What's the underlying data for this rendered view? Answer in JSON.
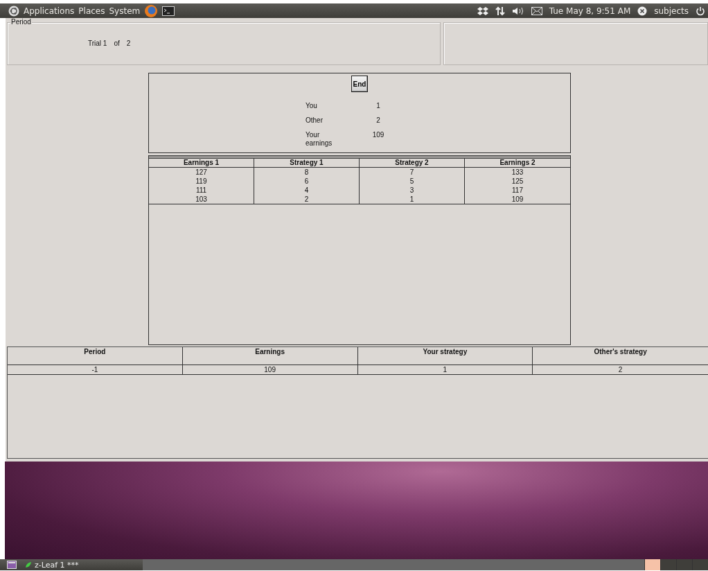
{
  "top_panel": {
    "menus": [
      "Applications",
      "Places",
      "System"
    ],
    "clock": "Tue May 8, 9:51 AM",
    "user": "subjects"
  },
  "period_box": {
    "title": "Period",
    "trial_label": "Trial 1",
    "of_label": "of",
    "total": "2"
  },
  "end_button": "End",
  "info": [
    {
      "label": "You",
      "value": "1"
    },
    {
      "label": "Other",
      "value": "2"
    },
    {
      "label": "Your earnings",
      "value": "109"
    }
  ],
  "strategy_table": {
    "columns": [
      "Earnings 1",
      "Strategy 1",
      "Strategy 2",
      "Earnings 2"
    ],
    "rows": [
      [
        "127",
        "8",
        "7",
        "133"
      ],
      [
        "119",
        "6",
        "5",
        "125"
      ],
      [
        "111",
        "4",
        "3",
        "117"
      ],
      [
        "103",
        "2",
        "1",
        "109"
      ]
    ]
  },
  "history_table": {
    "columns": [
      "Period",
      "Earnings",
      "Your strategy",
      "Other's strategy"
    ],
    "rows": [
      [
        "-1",
        "109",
        "1",
        "2"
      ]
    ]
  },
  "taskbar": {
    "items": [
      {
        "label": "z-Leaf 1 ***",
        "selected": false
      }
    ]
  }
}
